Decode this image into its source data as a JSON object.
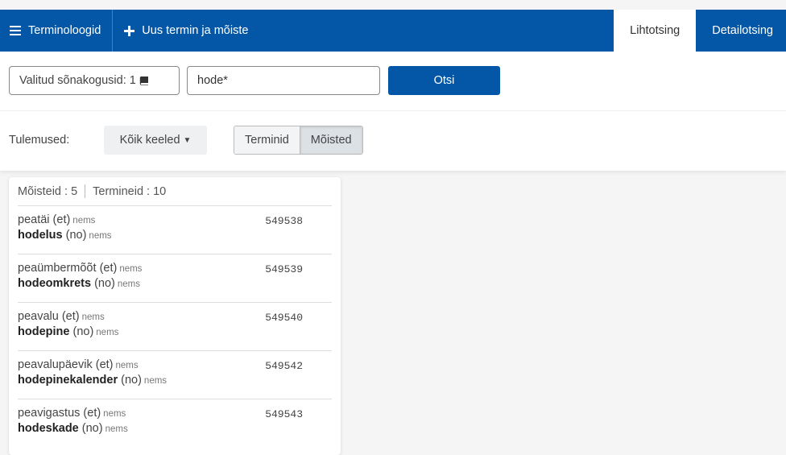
{
  "nav": {
    "menu_label": "Terminoloogid",
    "new_term_label": "Uus termin ja mõiste",
    "tabs": [
      {
        "label": "Lihtotsing",
        "active": true
      },
      {
        "label": "Detailotsing",
        "active": false
      }
    ]
  },
  "search": {
    "termbase_label": "Valitud sõnakogusid: 1",
    "query_value": "hode*",
    "button_label": "Otsi"
  },
  "filters": {
    "results_label": "Tulemused:",
    "language_selected": "Kõik keeled",
    "mode_options": [
      {
        "label": "Terminid",
        "active": false
      },
      {
        "label": "Mõisted",
        "active": true
      }
    ]
  },
  "results": {
    "concepts_count": "Mõisteid : 5",
    "terms_count": "Termineid : 10",
    "items": [
      {
        "et_term": "peatäi",
        "et_lang": "(et)",
        "et_source": "nems",
        "no_term": "hodelus",
        "no_lang": "(no)",
        "no_source": "nems",
        "id": "549538"
      },
      {
        "et_term": "peaümbermõõt",
        "et_lang": "(et)",
        "et_source": "nems",
        "no_term": "hodeomkrets",
        "no_lang": "(no)",
        "no_source": "nems",
        "id": "549539"
      },
      {
        "et_term": "peavalu",
        "et_lang": "(et)",
        "et_source": "nems",
        "no_term": "hodepine",
        "no_lang": "(no)",
        "no_source": "nems",
        "id": "549540"
      },
      {
        "et_term": "peavalupäevik",
        "et_lang": "(et)",
        "et_source": "nems",
        "no_term": "hodepinekalender",
        "no_lang": "(no)",
        "no_source": "nems",
        "id": "549542"
      },
      {
        "et_term": "peavigastus",
        "et_lang": "(et)",
        "et_source": "nems",
        "no_term": "hodeskade",
        "no_lang": "(no)",
        "no_source": "nems",
        "id": "549543"
      }
    ]
  },
  "colors": {
    "primary": "#0357a6",
    "page_bg": "#f5f5f5"
  },
  "icons": {
    "menu": "hamburger-icon",
    "add": "plus-icon",
    "termbase": "book-icon",
    "dropdown": "caret-down-icon"
  }
}
